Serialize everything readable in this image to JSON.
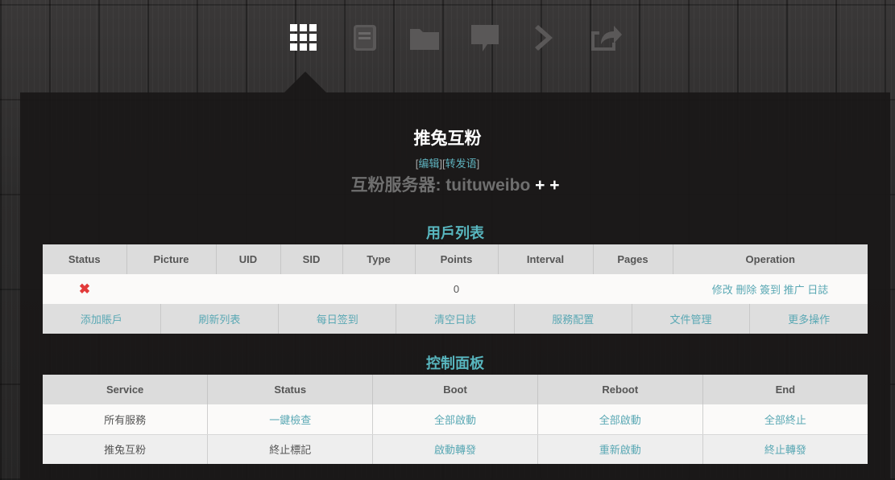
{
  "nav_icons": [
    "grid-icon",
    "book-icon",
    "folder-icon",
    "comment-icon",
    "chevron-right-icon",
    "share-icon"
  ],
  "header": {
    "title": "推兔互粉",
    "edit_open": "[",
    "edit_link": "编辑",
    "edit_mid": "][",
    "forward_link": "转发语",
    "edit_close": "]",
    "server_label": "互粉服务器: tuituweibo",
    "server_plus": "+ +"
  },
  "users": {
    "heading": "用戶列表",
    "columns": [
      "Status",
      "Picture",
      "UID",
      "SID",
      "Type",
      "Points",
      "Interval",
      "Pages",
      "Operation"
    ],
    "row": {
      "status_icon": "✖",
      "points": "0",
      "ops": [
        "修改",
        "刪除",
        "簽到",
        "推广",
        "日誌"
      ]
    },
    "actions": [
      "添加賬戶",
      "刷新列表",
      "每日签到",
      "清空日誌",
      "服務配置",
      "文件管理",
      "更多操作"
    ]
  },
  "control": {
    "heading": "控制面板",
    "columns": [
      "Service",
      "Status",
      "Boot",
      "Reboot",
      "End"
    ],
    "rows": [
      {
        "service": "所有服務",
        "status": "一鍵檢查",
        "boot": "全部啟動",
        "reboot": "全部啟動",
        "end": "全部終止"
      },
      {
        "service": "推兔互粉",
        "status": "終止標記",
        "boot": "啟動轉發",
        "reboot": "重新啟動",
        "end": "終止轉發"
      }
    ]
  },
  "colors": {
    "accent": "#58b6bf",
    "link": "#5aa8b4",
    "error": "#e23a3a"
  }
}
